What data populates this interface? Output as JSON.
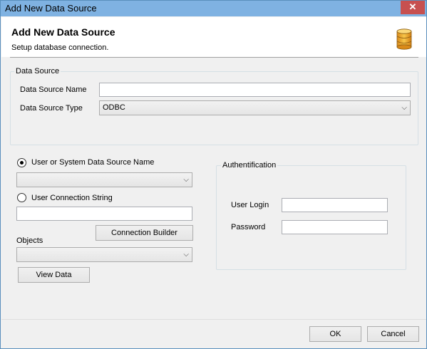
{
  "window": {
    "title": "Add New Data Source",
    "close_glyph": "✕"
  },
  "header": {
    "title": "Add New Data Source",
    "subtitle": "Setup database connection.",
    "icon": "database-icon"
  },
  "data_source": {
    "group_label": "Data Source",
    "name_label": "Data Source Name",
    "name_value": "",
    "type_label": "Data Source Type",
    "type_value": "ODBC"
  },
  "connection": {
    "dsn_radio_label": "User or System Data Source Name",
    "dsn_selected": true,
    "dsn_value": "",
    "conn_string_radio_label": "User Connection String",
    "conn_string_value": "",
    "connection_builder_label": "Connection Builder",
    "objects_label": "Objects",
    "objects_value": "",
    "view_data_label": "View Data"
  },
  "authentication": {
    "group_label": "Authentification",
    "login_label": "User Login",
    "login_value": "",
    "password_label": "Password",
    "password_value": ""
  },
  "footer": {
    "ok_label": "OK",
    "cancel_label": "Cancel"
  },
  "colors": {
    "titlebar": "#7fb2e2",
    "close_button": "#c75050",
    "window_bg": "#f0f0f0"
  }
}
